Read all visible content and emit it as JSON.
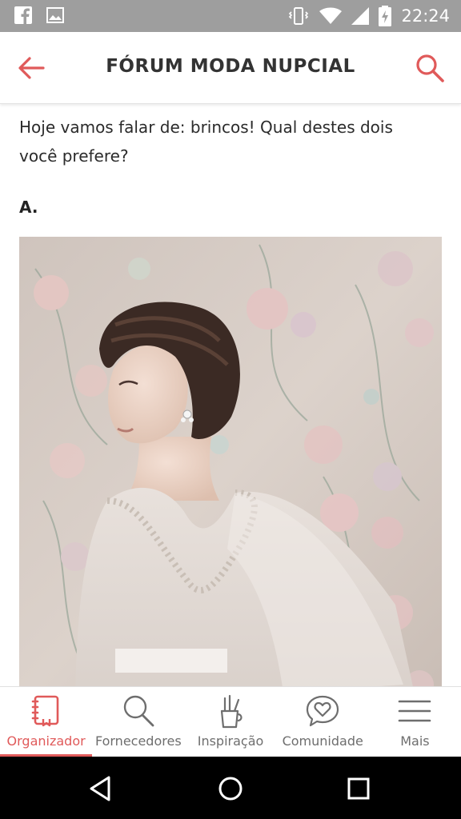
{
  "status_bar": {
    "time": "22:24",
    "left_icons": [
      "facebook-icon",
      "image-icon"
    ],
    "right_icons": [
      "vibrate-icon",
      "wifi-icon",
      "signal-icon",
      "battery-charging-icon"
    ]
  },
  "app_bar": {
    "title": "FÓRUM MODA NUPCIAL",
    "back_icon": "arrow-left-icon",
    "search_icon": "search-icon",
    "accent_color": "#e05a5a"
  },
  "post": {
    "text": "Hoje vamos falar de: brincos! Qual destes dois você prefere?",
    "option_label": "A."
  },
  "bottom_nav": {
    "items": [
      {
        "label": "Organizador",
        "icon": "notebook-icon",
        "active": true
      },
      {
        "label": "Fornecedores",
        "icon": "search-icon",
        "active": false
      },
      {
        "label": "Inspiração",
        "icon": "brushes-cup-icon",
        "active": false
      },
      {
        "label": "Comunidade",
        "icon": "heart-chat-icon",
        "active": false
      },
      {
        "label": "Mais",
        "icon": "menu-icon",
        "active": false
      }
    ]
  },
  "system_nav": {
    "buttons": [
      "back-triangle-icon",
      "home-circle-icon",
      "recents-square-icon"
    ]
  }
}
